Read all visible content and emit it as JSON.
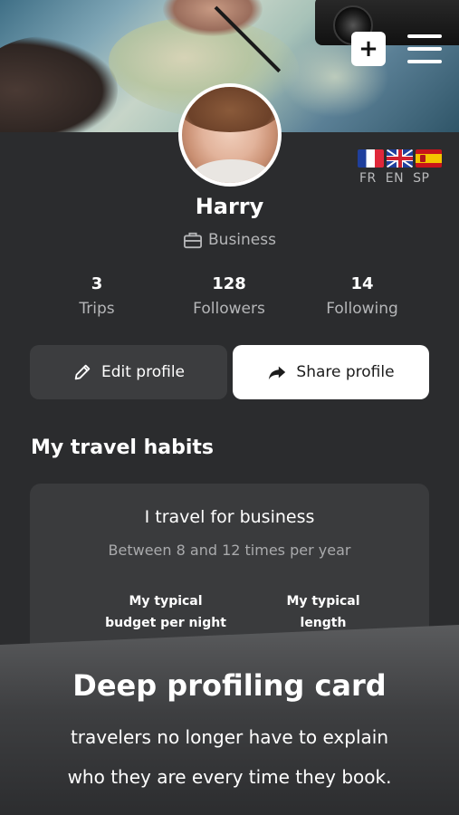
{
  "header": {
    "add_label": "+",
    "languages": [
      {
        "code": "FR",
        "flag": "france-flag"
      },
      {
        "code": "EN",
        "flag": "uk-flag"
      },
      {
        "code": "SP",
        "flag": "spain-flag"
      }
    ]
  },
  "profile": {
    "name": "Harry",
    "role": "Business",
    "stats": [
      {
        "value": "3",
        "label": "Trips"
      },
      {
        "value": "128",
        "label": "Followers"
      },
      {
        "value": "14",
        "label": "Following"
      }
    ]
  },
  "actions": {
    "edit_label": "Edit profile",
    "share_label": "Share profile"
  },
  "habits": {
    "title": "My travel habits",
    "card": {
      "headline": "I travel for business",
      "frequency": "Between 8 and 12 times per year",
      "col1_line1": "My typical",
      "col1_line2": "budget per night",
      "col2_line1": "My typical",
      "col2_line2": "length"
    }
  },
  "banner": {
    "title": "Deep profiling card",
    "line1": "travelers no longer have to explain",
    "line2": "who they are every time they book."
  },
  "colors": {
    "background": "#2b2c2e",
    "card": "#3a3b3d",
    "button_dark": "#3c3d3f",
    "button_light": "#ffffff",
    "muted_text": "#b5b6b8"
  }
}
